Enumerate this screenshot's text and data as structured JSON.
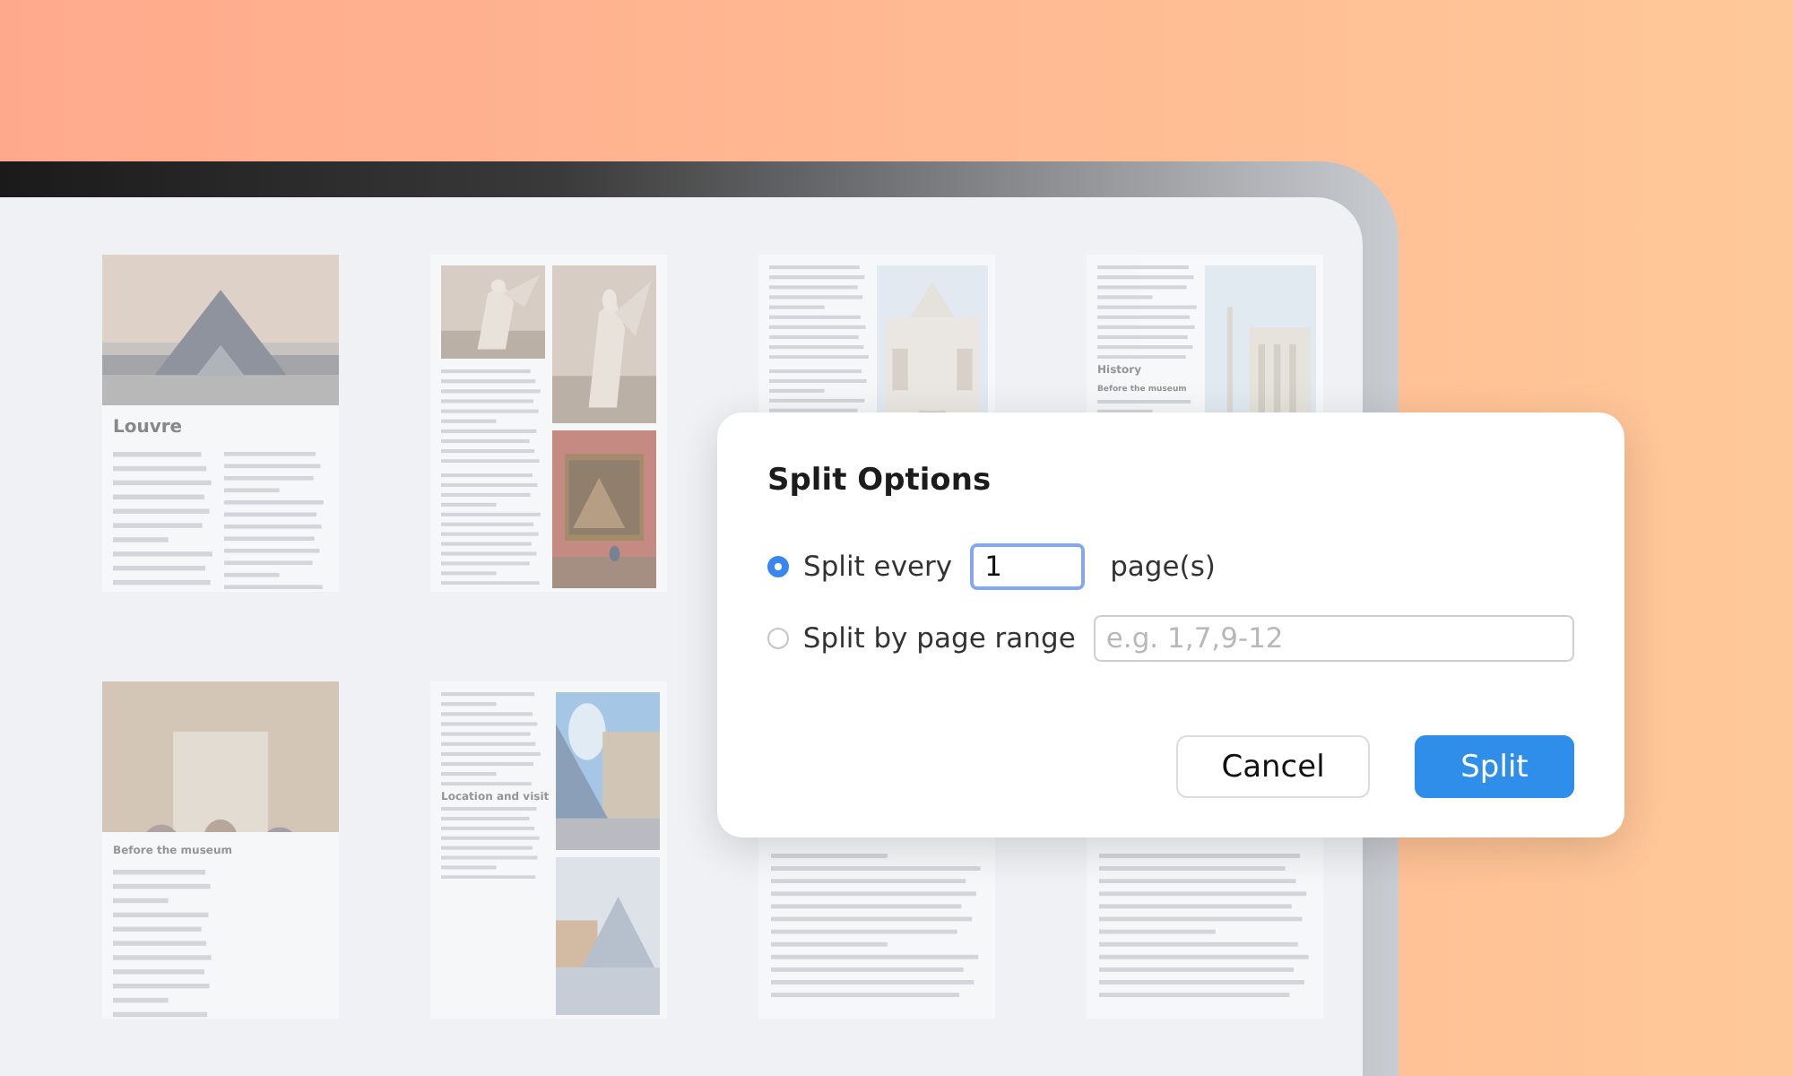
{
  "pages": [
    {
      "kind": "photo-top",
      "headings": [
        "Louvre"
      ]
    },
    {
      "kind": "collage"
    },
    {
      "kind": "text-photo"
    },
    {
      "kind": "text-photo",
      "headings": [
        "History",
        "Before the museum"
      ]
    },
    {
      "kind": "photo-top",
      "headings": [
        "Before the museum"
      ]
    },
    {
      "kind": "text-two-photos",
      "headings": [
        "Location and visit"
      ]
    },
    {
      "kind": "text"
    },
    {
      "kind": "text"
    }
  ],
  "dialog": {
    "title": "Split Options",
    "options": [
      {
        "label": "Split every",
        "selected": true,
        "field": {
          "value": "1",
          "focused": true
        },
        "suffix": "page(s)"
      },
      {
        "label": "Split by page range",
        "selected": false,
        "field": {
          "placeholder": "e.g. 1,7,9-12",
          "focused": false
        }
      }
    ],
    "buttons": [
      {
        "label": "Cancel",
        "kind": "secondary"
      },
      {
        "label": "Split",
        "kind": "primary"
      }
    ]
  }
}
